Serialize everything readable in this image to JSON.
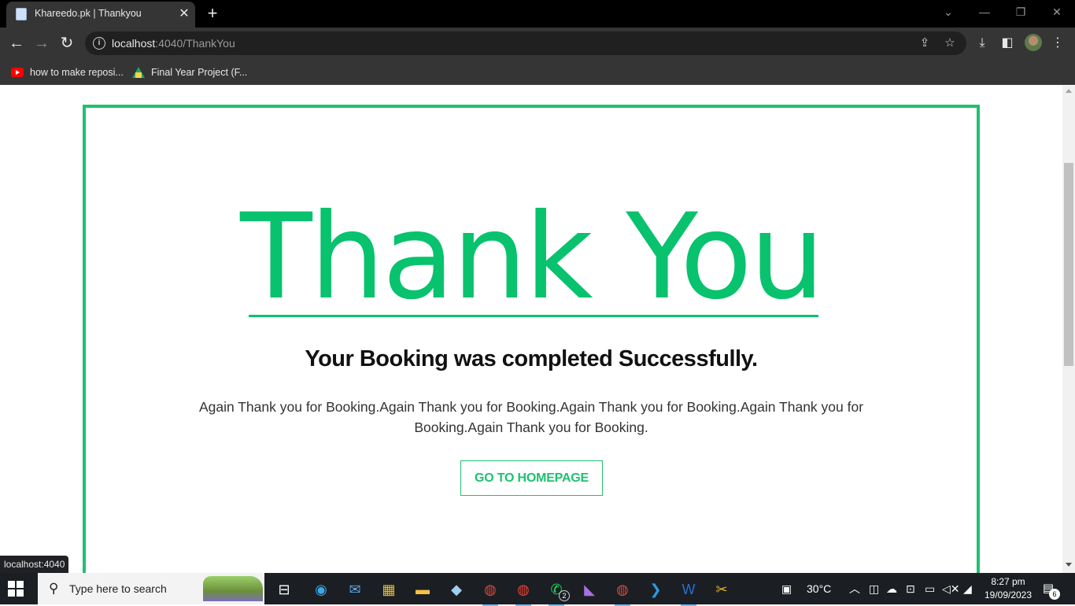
{
  "browser": {
    "tab_title": "Khareedo.pk | Thankyou",
    "tab_close": "✕",
    "new_tab": "+",
    "url_host": "localhost",
    "url_path": ":4040/ThankYou",
    "window_controls": {
      "minimize": "—",
      "restore": "❐",
      "close": "✕",
      "tab_search": "⌄"
    },
    "nav": {
      "back": "←",
      "forward": "→",
      "reload": "↻"
    },
    "bookmarks": [
      {
        "label": "how to make reposi..."
      },
      {
        "label": "Final Year Project (F..."
      }
    ]
  },
  "page": {
    "heading": "Thank You",
    "subtitle": "Your Booking was completed Successfully.",
    "message": "Again Thank you for Booking.Again Thank you for Booking.Again Thank you for Booking.Again Thank you for Booking.Again Thank you for Booking.",
    "button_label": "GO TO HOMEPAGE",
    "accent_color": "#08c26e"
  },
  "status_tooltip": "localhost:4040",
  "taskbar": {
    "search_placeholder": "Type here to search",
    "weather": "30°C",
    "time": "8:27 pm",
    "date": "19/09/2023",
    "whatsapp_badge": "2",
    "notification_count": "6"
  }
}
